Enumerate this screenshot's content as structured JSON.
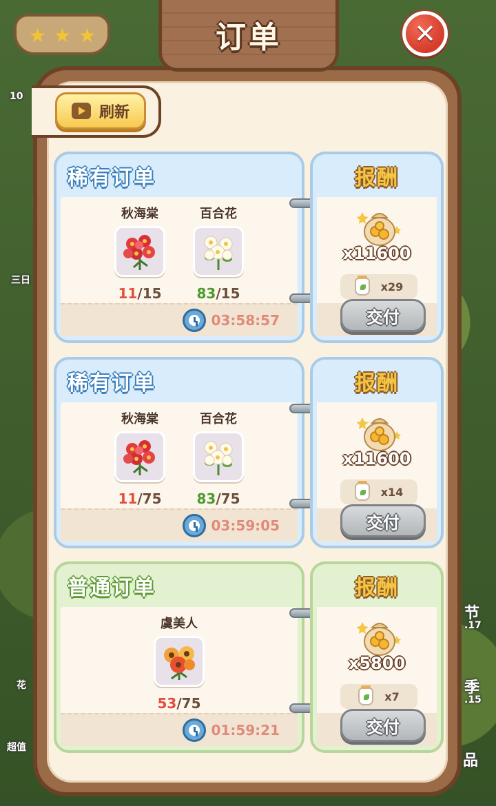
{
  "title": "订单",
  "refresh_label": "刷新",
  "background_labels": {
    "count_10": "10",
    "shop_label": "超值",
    "right_label_1": "节",
    "right_label_1_num": ".17",
    "right_label_2": "季",
    "right_label_2_num": ".15",
    "right_label_3": "品",
    "left_label_1": "三日",
    "left_label_2": "花"
  },
  "orders": [
    {
      "type_label": "稀有订单",
      "theme": "blue",
      "flowers": [
        {
          "name": "秋海棠",
          "have": "11",
          "need": "/15",
          "status": "short",
          "icon": "begonia-flower-icon"
        },
        {
          "name": "百合花",
          "have": "83",
          "need": "/15",
          "status": "enough",
          "icon": "lily-flower-icon"
        }
      ],
      "timer": "03:58:57",
      "reward_title": "报酬",
      "coins": "x11600",
      "seeds": "x29",
      "deliver_label": "交付"
    },
    {
      "type_label": "稀有订单",
      "theme": "blue",
      "flowers": [
        {
          "name": "秋海棠",
          "have": "11",
          "need": "/75",
          "status": "short",
          "icon": "begonia-flower-icon"
        },
        {
          "name": "百合花",
          "have": "83",
          "need": "/75",
          "status": "enough",
          "icon": "lily-flower-icon"
        }
      ],
      "timer": "03:59:05",
      "reward_title": "报酬",
      "coins": "x11600",
      "seeds": "x14",
      "deliver_label": "交付"
    },
    {
      "type_label": "普通订单",
      "theme": "green",
      "flowers": [
        {
          "name": "虞美人",
          "have": "53",
          "need": "/75",
          "status": "short",
          "icon": "poppy-flower-icon"
        }
      ],
      "timer": "01:59:21",
      "reward_title": "报酬",
      "coins": "x5800",
      "seeds": "x7",
      "deliver_label": "交付"
    }
  ],
  "colors": {
    "rare_theme": "#d9ecfb",
    "normal_theme": "#e2f1cf",
    "short_count": "#e0503a",
    "enough_count": "#4a9a2e",
    "panel_wood": "#9b6a47"
  }
}
